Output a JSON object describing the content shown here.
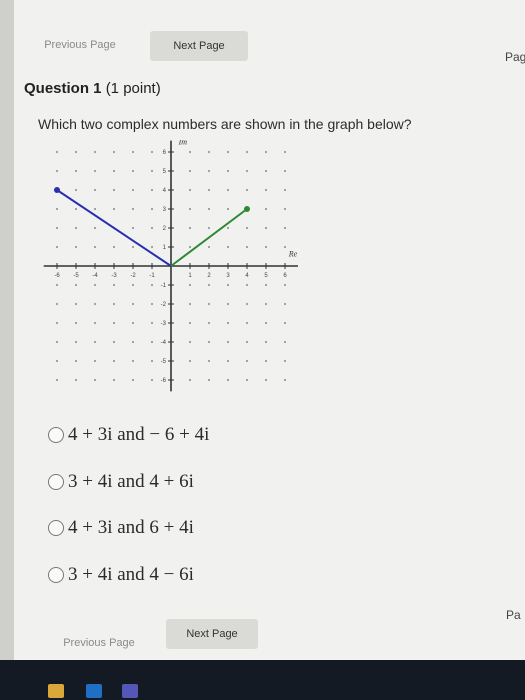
{
  "nav_top": {
    "previous": "Previous Page",
    "next": "Next Page",
    "page_label": "Pag"
  },
  "question": {
    "number": "Question 1",
    "points": "(1 point)",
    "text": "Which two complex numbers are shown in the graph below?"
  },
  "graph": {
    "axis_x_label": "Re",
    "axis_y_label": "Im",
    "x_ticks": [
      "-6",
      "-5",
      "-4",
      "-3",
      "-2",
      "-1",
      "1",
      "2",
      "3",
      "4",
      "5",
      "6"
    ],
    "y_ticks": [
      "6",
      "5",
      "4",
      "3",
      "2",
      "1",
      "-1",
      "-2",
      "-3",
      "-4",
      "-5",
      "-6"
    ],
    "vectors": [
      {
        "name": "blue",
        "x": -6,
        "y": 4,
        "color": "#2b2fb0"
      },
      {
        "name": "green",
        "x": 4,
        "y": 3,
        "color": "#2c8a34"
      }
    ]
  },
  "options": [
    {
      "label": "4 + 3i and − 6 + 4i"
    },
    {
      "label": "3 + 4i and 4 + 6i"
    },
    {
      "label": "4 + 3i and 6 + 4i"
    },
    {
      "label": "3 + 4i and 4 − 6i"
    }
  ],
  "nav_bottom": {
    "previous": "Previous Page",
    "next": "Next Page",
    "page_label": "Pa"
  }
}
